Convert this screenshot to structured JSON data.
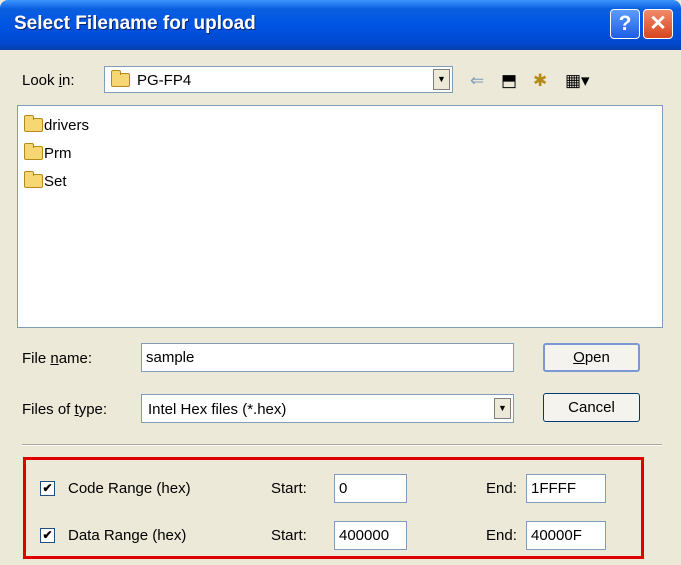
{
  "window": {
    "title": "Select Filename for upload",
    "help_glyph": "?",
    "close_glyph": "✕"
  },
  "lookin": {
    "label_pre": "Look ",
    "label_key": "i",
    "label_post": "n:",
    "value": "PG-FP4",
    "dropdown_glyph": "▼"
  },
  "toolbar": {
    "back_glyph": "⇐",
    "up_glyph": "⬒",
    "newfolder_glyph": "✱",
    "view_glyph": "▦▾"
  },
  "files": [
    {
      "name": "drivers",
      "icon": "folder-icon"
    },
    {
      "name": "Prm",
      "icon": "folder-icon"
    },
    {
      "name": "Set",
      "icon": "folder-icon"
    }
  ],
  "filename": {
    "label_pre": "File ",
    "label_key": "n",
    "label_post": "ame:",
    "value": "sample"
  },
  "filetype": {
    "label_pre": "Files of ",
    "label_key": "t",
    "label_post": "ype:",
    "value": "Intel Hex files (*.hex)",
    "dropdown_glyph": "▼"
  },
  "buttons": {
    "open_key": "O",
    "open_rest": "pen",
    "cancel": "Cancel"
  },
  "ranges": {
    "code": {
      "checked": true,
      "check_glyph": "✔",
      "label": "Code Range (hex)",
      "start_label": "Start:",
      "start": "0",
      "end_label": "End:",
      "end": "1FFFF"
    },
    "data": {
      "checked": true,
      "check_glyph": "✔",
      "label": "Data Range (hex)",
      "start_label": "Start:",
      "start": "400000",
      "end_label": "End:",
      "end": "40000F"
    }
  },
  "colors": {
    "titlebar": "#0054e3",
    "dialog_bg": "#ece9d8",
    "highlight": "#e00000"
  }
}
